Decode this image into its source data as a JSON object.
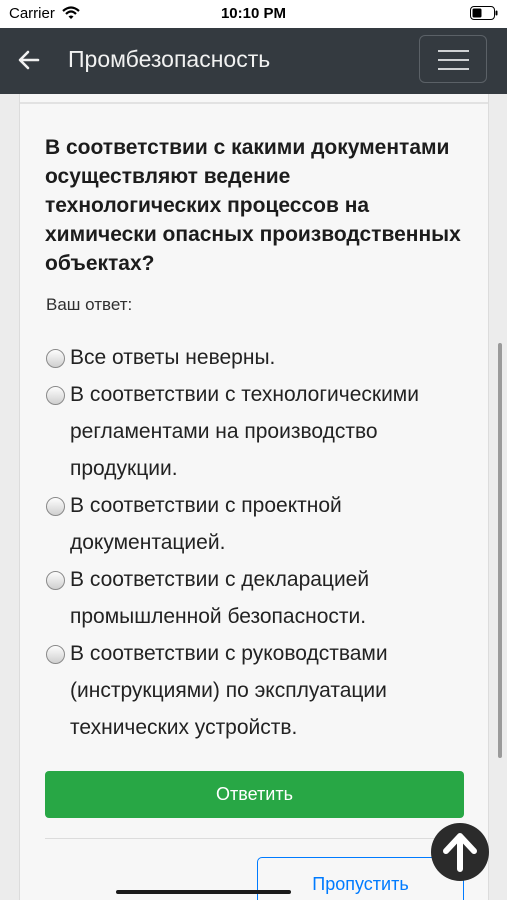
{
  "status_bar": {
    "carrier": "Carrier",
    "time": "10:10 PM"
  },
  "navbar": {
    "title": "Промбезопасность"
  },
  "question": {
    "text": "В соответствии с какими документами осуществляют ведение технологических процессов на химически опасных производственных объектах?",
    "answer_label": "Ваш ответ:",
    "options": [
      "Все ответы неверны.",
      "В соответствии с технологическими регламентами на производство продукции.",
      "В соответствии с проектной документацией.",
      "В соответствии с декларацией промышленной безопасности.",
      "В соответствии с руководствами (инструкциями) по эксплуатации технических устройств."
    ]
  },
  "buttons": {
    "submit": "Ответить",
    "skip": "Пропустить"
  },
  "colors": {
    "navbar": "#343a40",
    "submit": "#28a745",
    "skip": "#007bff"
  }
}
